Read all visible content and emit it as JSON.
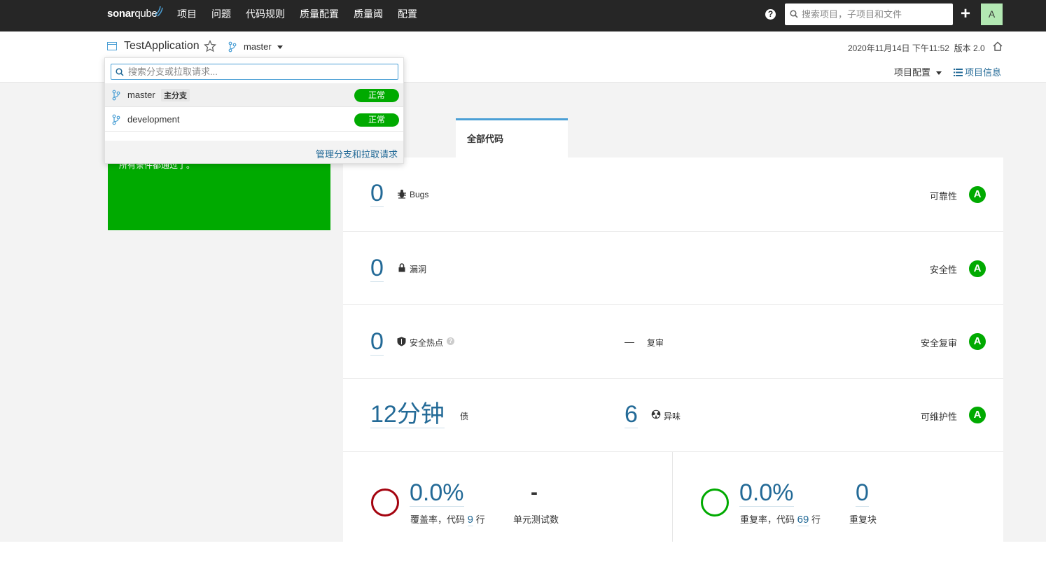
{
  "topbar": {
    "logo_main": "sonar",
    "logo_sub": "qube",
    "nav": [
      "项目",
      "问题",
      "代码规则",
      "质量配置",
      "质量阈",
      "配置"
    ],
    "help_label": "?",
    "search_placeholder": "搜索项目，子项目和文件",
    "add_label": "+",
    "avatar_letter": "A"
  },
  "project": {
    "name": "TestApplication",
    "branch": "master",
    "date": "2020年11月14日 下午11:52",
    "version": "版本 2.0",
    "config_label": "项目配置",
    "info_label": "项目信息"
  },
  "branch_dropdown": {
    "search_placeholder": "搜索分支或拉取请求...",
    "branches": [
      {
        "name": "master",
        "tag": "主分支",
        "status": "正常"
      },
      {
        "name": "development",
        "tag": "",
        "status": "正常"
      }
    ],
    "manage_label": "管理分支和拉取请求"
  },
  "quality_gate": {
    "message": "所有条件都通过了。"
  },
  "tabs": {
    "active": "全部代码"
  },
  "metrics": {
    "bugs": {
      "value": "0",
      "label": "Bugs",
      "rating_label": "可靠性",
      "rating": "A"
    },
    "vulnerabilities": {
      "value": "0",
      "label": "漏洞",
      "rating_label": "安全性",
      "rating": "A"
    },
    "hotspots": {
      "value": "0",
      "label": "安全热点",
      "review_value": "—",
      "review_label": "复审",
      "rating_label": "安全复审",
      "rating": "A"
    },
    "debt": {
      "value": "12分钟",
      "label": "债",
      "smells_value": "6",
      "smells_label": "异味",
      "rating_label": "可维护性",
      "rating": "A"
    },
    "coverage": {
      "value": "0.0%",
      "label_prefix": "覆盖率，代码",
      "lines": "9",
      "label_suffix": "行",
      "tests_value": "-",
      "tests_label": "单元测试数"
    },
    "duplication": {
      "value": "0.0%",
      "label_prefix": "重复率，代码",
      "lines": "69",
      "label_suffix": "行",
      "blocks_value": "0",
      "blocks_label": "重复块"
    }
  },
  "colors": {
    "topbar": "#262626",
    "accent": "#236a97",
    "pass": "#00aa00",
    "coverage_ring": "#a4030f",
    "dup_ring": "#00aa00"
  }
}
